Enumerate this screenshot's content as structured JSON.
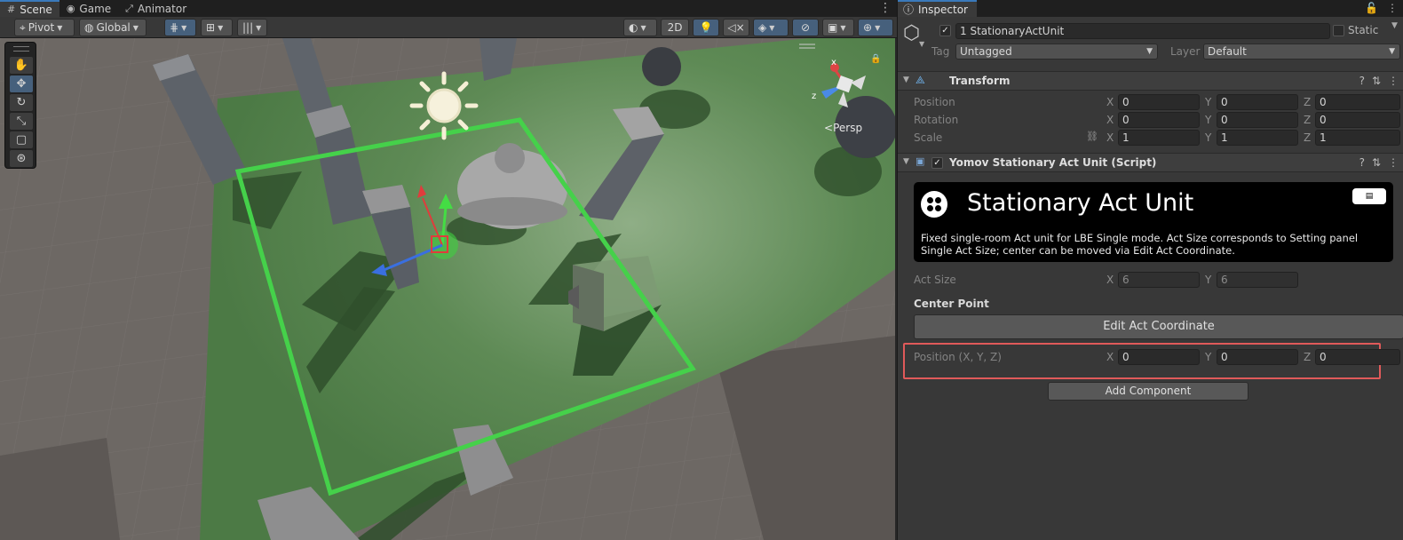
{
  "scene_tabs": [
    {
      "label": "Scene",
      "icon": "grid-icon"
    },
    {
      "label": "Game",
      "icon": "gamepad-icon"
    },
    {
      "label": "Animator",
      "icon": "animator-icon"
    }
  ],
  "toolbar": {
    "pivot_label": "Pivot",
    "global_label": "Global",
    "mode_2d_label": "2D"
  },
  "scene_view": {
    "projection_label": "Persp",
    "gizmo_axes": {
      "x": "x",
      "z": "z"
    }
  },
  "inspector": {
    "tab_label": "Inspector",
    "object": {
      "name": "1 StationaryActUnit",
      "static_label": "Static",
      "tag_label": "Tag",
      "tag_value": "Untagged",
      "layer_label": "Layer",
      "layer_value": "Default"
    },
    "transform": {
      "title": "Transform",
      "rows": [
        {
          "label": "Position",
          "x": "0",
          "y": "0",
          "z": "0"
        },
        {
          "label": "Rotation",
          "x": "0",
          "y": "0",
          "z": "0"
        },
        {
          "label": "Scale",
          "x": "1",
          "y": "1",
          "z": "1"
        }
      ]
    },
    "script": {
      "title": "Yomov Stationary Act Unit (Script)",
      "banner_title": "Stationary Act Unit",
      "banner_description": "Fixed single-room Act unit for LBE Single mode. Act Size corresponds to Setting panel Single Act Size; center can be moved via Edit Act Coordinate.",
      "act_size_label": "Act Size",
      "act_size_x": "6",
      "act_size_y": "6",
      "center_point_label": "Center Point",
      "edit_button_label": "Edit Act Coordinate",
      "position_label": "Position (X, Y, Z)",
      "position_x": "0",
      "position_y": "0",
      "position_z": "0"
    },
    "add_component_label": "Add Component",
    "axis_labels": {
      "x": "X",
      "y": "Y",
      "z": "Z"
    }
  }
}
